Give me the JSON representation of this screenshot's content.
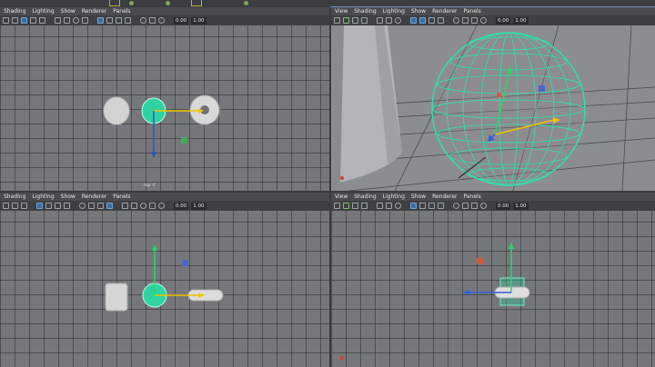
{
  "app": {
    "title": ""
  },
  "menus": {
    "left": [
      "Shading",
      "Lighting",
      "Show",
      "Renderer",
      "Panels"
    ],
    "right": [
      "View",
      "Shading",
      "Lighting",
      "Show",
      "Renderer",
      "Panels"
    ]
  },
  "toolbar": {
    "value_a": "0.00",
    "value_b": "1.00"
  },
  "viewports": {
    "top": {
      "camera_label": "top -Y"
    },
    "persp": {
      "camera_label": ""
    },
    "front": {
      "camera_label": ""
    },
    "side": {
      "camera_label": ""
    }
  },
  "icons": [
    "select-tool-icon",
    "lasso-icon",
    "move-icon",
    "rotate-icon",
    "scale-icon",
    "grid-icon",
    "camera-icon",
    "wireframe-icon",
    "smooth-shade-icon",
    "texture-icon",
    "light-icon",
    "shadow-icon",
    "xray-icon",
    "isolate-icon",
    "gate-icon",
    "gear-icon"
  ],
  "colors": {
    "accent_green": "#2fcfa0",
    "axis_x": "#f0c400",
    "axis_y": "#3fbf3f",
    "axis_z": "#3060d8",
    "grid": "#76777a",
    "menubar": "#4a4b4d"
  }
}
